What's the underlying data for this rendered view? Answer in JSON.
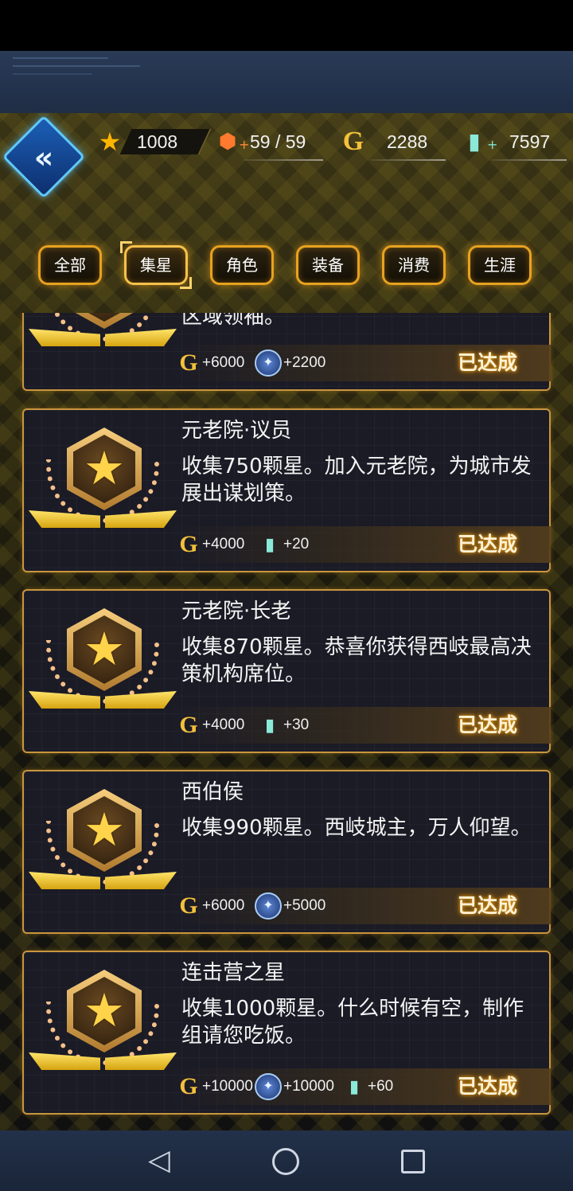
{
  "header": {
    "stars": "1008",
    "energy": "59 / 59",
    "gold": "2288",
    "cells": "7597"
  },
  "tabs": [
    "全部",
    "集星",
    "角色",
    "装备",
    "消费",
    "生涯"
  ],
  "active_tab": "集星",
  "cards": [
    {
      "title": "",
      "desc": "区域领袖。",
      "rewards": [
        {
          "icon": "gold-icon",
          "value": "+6000"
        },
        {
          "icon": "gem-icon",
          "value": "+2200"
        }
      ],
      "status": "已达成"
    },
    {
      "title": "元老院·议员",
      "desc": "收集750颗星。加入元老院，为城市发展出谋划策。",
      "rewards": [
        {
          "icon": "gold-icon",
          "value": "+4000"
        },
        {
          "icon": "cell-icon",
          "value": "+20"
        }
      ],
      "status": "已达成"
    },
    {
      "title": "元老院·长老",
      "desc": "收集870颗星。恭喜你获得西岐最高决策机构席位。",
      "rewards": [
        {
          "icon": "gold-icon",
          "value": "+4000"
        },
        {
          "icon": "cell-icon",
          "value": "+30"
        }
      ],
      "status": "已达成"
    },
    {
      "title": "西伯侯",
      "desc": "收集990颗星。西岐城主，万人仰望。",
      "rewards": [
        {
          "icon": "gold-icon",
          "value": "+6000"
        },
        {
          "icon": "gem-icon",
          "value": "+5000"
        }
      ],
      "status": "已达成"
    },
    {
      "title": "连击营之星",
      "desc": "收集1000颗星。什么时候有空，制作组请您吃饭。",
      "rewards": [
        {
          "icon": "gold-icon",
          "value": "+10000"
        },
        {
          "icon": "gem-icon",
          "value": "+10000"
        },
        {
          "icon": "cell-icon",
          "value": "+60"
        }
      ],
      "status": "已达成"
    }
  ],
  "colors": {
    "accent": "#e7a21f",
    "panel": "#1b1b26",
    "back_button": "#1b5fb6"
  }
}
